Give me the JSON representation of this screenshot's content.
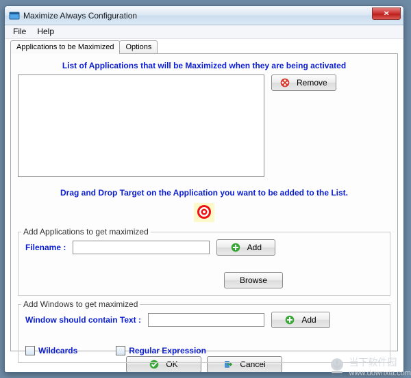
{
  "window": {
    "title": "Maximize Always Configuration",
    "close_label": "×"
  },
  "menubar": [
    "File",
    "Help"
  ],
  "tabs": [
    {
      "label": "Applications to be Maximized",
      "active": true
    },
    {
      "label": "Options",
      "active": false
    }
  ],
  "heading1": "List of Applications that will be Maximized when they are being activated",
  "remove_button": "Remove",
  "heading2": "Drag and Drop Target on the Application you want to be added to the List.",
  "group_apps": {
    "title": "Add Applications to get maximized",
    "filename_label": "Filename :",
    "filename_value": "",
    "add_label": "Add",
    "browse_label": "Browse"
  },
  "group_windows": {
    "title": "Add Windows to get maximized",
    "text_label": "Window should contain Text :",
    "text_value": "",
    "add_label": "Add",
    "wildcards_label": "Wildcards",
    "regex_label": "Regular Expression"
  },
  "bottom": {
    "ok": "OK",
    "cancel": "Cancel"
  },
  "watermark": {
    "name": "当下软件园",
    "url": "www.downxia.com"
  },
  "icons": {
    "app": "app-icon",
    "close": "close-icon",
    "remove": "remove-circle-icon",
    "add": "add-circle-icon",
    "ok": "ok-check-icon",
    "cancel": "cancel-door-icon",
    "target": "target-icon"
  }
}
